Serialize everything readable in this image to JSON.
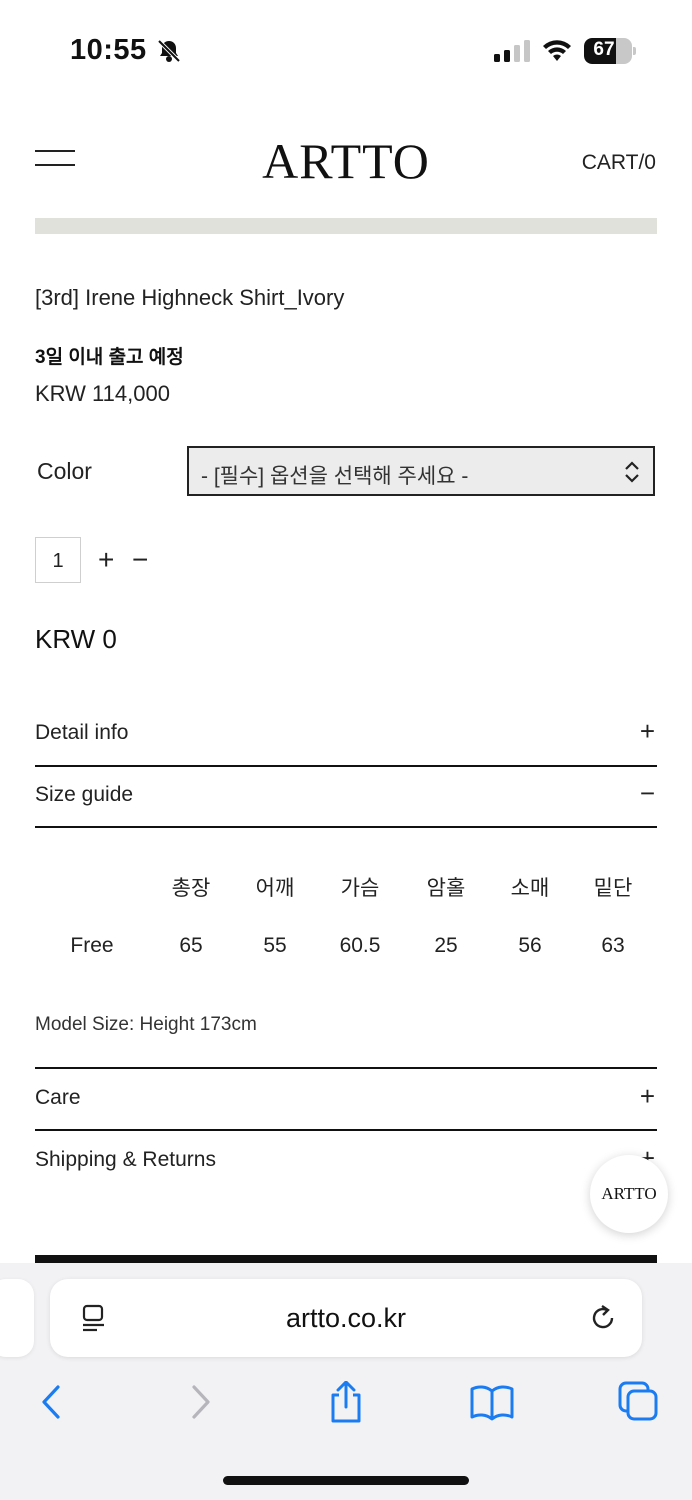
{
  "status_bar": {
    "time": "10:55",
    "battery": "67",
    "battery_level": 0.67
  },
  "header": {
    "logo": "ARTTO",
    "cart_label": "CART/0"
  },
  "product": {
    "name": "[3rd] Irene Highneck Shirt_Ivory",
    "shipping_note": "3일 이내 출고 예정",
    "price": "KRW 114,000"
  },
  "option": {
    "label": "Color",
    "selected": "- [필수] 옵션을 선택해 주세요 -"
  },
  "quantity": {
    "value": "1",
    "plus": "+",
    "minus": "−"
  },
  "total": "KRW 0",
  "accordion": {
    "detail": {
      "label": "Detail info",
      "sign": "+"
    },
    "size": {
      "label": "Size guide",
      "sign": "−"
    },
    "care": {
      "label": "Care",
      "sign": "+"
    },
    "shipping": {
      "label": "Shipping & Returns",
      "sign": "+"
    }
  },
  "size_table": {
    "headers": [
      "총장",
      "어깨",
      "가슴",
      "암홀",
      "소매",
      "밑단"
    ],
    "row_label": "Free",
    "values": [
      "65",
      "55",
      "60.5",
      "25",
      "56",
      "63"
    ]
  },
  "model_size": "Model Size: Height 173cm",
  "floating_badge": "ARTTO",
  "browser": {
    "url": "artto.co.kr"
  },
  "colors": {
    "accent": "#1a7cf0",
    "text": "#222222",
    "strip": "#e1e1dc"
  }
}
